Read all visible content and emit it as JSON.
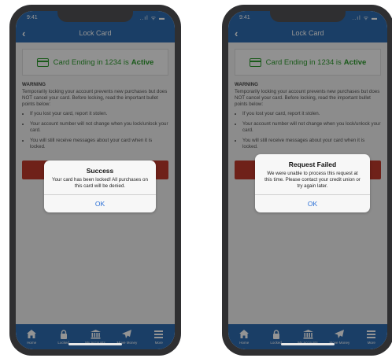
{
  "phones": [
    {
      "status": {
        "time": "9:41",
        "icons": "..ıl ᯤ ▬"
      },
      "nav": {
        "back": "‹",
        "title": "Lock Card"
      },
      "card": {
        "prefix": "Card Ending in 1234 is",
        "state": "Active"
      },
      "warning": {
        "title": "WARNING",
        "text": "Temporarily locking your account prevents new purchases but does NOT cancel your card. Before locking, read the important bullet points below:",
        "bullets": [
          "If you lost your card, report it stolen.",
          "Your account number will not change when you lock/unlock your card.",
          "You will still receive messages about your card when it is locked."
        ]
      },
      "alert": {
        "title": "Success",
        "message": "Your card has been locked! All purchases on this card will be denied.",
        "ok": "OK"
      },
      "tabs": [
        {
          "label": "Home",
          "icon": "home-icon"
        },
        {
          "label": "Locked",
          "icon": "lock-icon"
        },
        {
          "label": "My Accounts",
          "icon": "bank-icon"
        },
        {
          "label": "Move Money",
          "icon": "paper-plane-icon"
        },
        {
          "label": "More",
          "icon": "menu-icon"
        }
      ]
    },
    {
      "status": {
        "time": "9:41",
        "icons": "..ıl ᯤ ▬"
      },
      "nav": {
        "back": "‹",
        "title": "Lock Card"
      },
      "card": {
        "prefix": "Card Ending in 1234 is",
        "state": "Active"
      },
      "warning": {
        "title": "WARNING",
        "text": "Temporarily locking your account prevents new purchases but does NOT cancel your card. Before locking, read the important bullet points below:",
        "bullets": [
          "If you lost your card, report it stolen.",
          "Your account number will not change when you lock/unlock your card.",
          "You will still receive messages about your card when it is locked."
        ]
      },
      "alert": {
        "title": "Request Failed",
        "message": "We were unable to process this request at this time. Please contact your credit union or try again later.",
        "ok": "OK"
      },
      "tabs": [
        {
          "label": "Home",
          "icon": "home-icon"
        },
        {
          "label": "Locked",
          "icon": "lock-icon"
        },
        {
          "label": "My Accounts",
          "icon": "bank-icon"
        },
        {
          "label": "Move Money",
          "icon": "paper-plane-icon"
        },
        {
          "label": "More",
          "icon": "menu-icon"
        }
      ]
    }
  ],
  "colors": {
    "brand": "#2d6bb0",
    "active_green": "#2e9b2e",
    "danger": "#c0392b",
    "link_blue": "#2a6fd6"
  }
}
